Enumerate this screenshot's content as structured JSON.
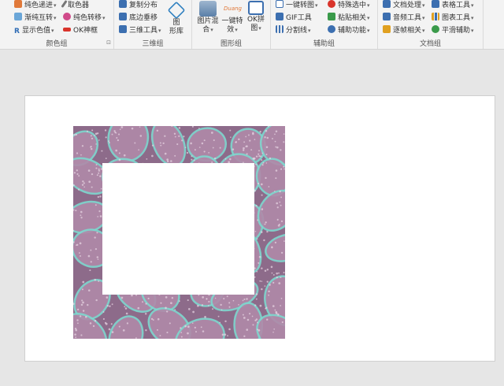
{
  "ribbon": {
    "groups": {
      "color": {
        "label": "颜色组",
        "items": [
          {
            "label": "纯色递进",
            "icon": "color-progress-icon",
            "color": "#e0793a"
          },
          {
            "label": "渐纯互转",
            "icon": "gradient-convert-icon",
            "color": "#6aa6d8"
          },
          {
            "label": "显示色值",
            "icon": "letter-r-icon",
            "color": "#2f6cb5"
          },
          {
            "label": "取色器",
            "icon": "eyedropper-icon",
            "color": "#555555"
          },
          {
            "label": "纯色转移",
            "icon": "color-transfer-icon",
            "color": "#d04a8a"
          },
          {
            "label": "OK神框",
            "icon": "ok-frame-icon",
            "color": "#d9342b"
          }
        ]
      },
      "three_d": {
        "label": "三维组",
        "items": [
          {
            "label": "复制分布",
            "icon": "copy-distribute-icon",
            "color": "#3c6fb0"
          },
          {
            "label": "底边垂移",
            "icon": "bottom-shift-icon",
            "color": "#3c6fb0"
          },
          {
            "label": "三维工具",
            "icon": "3d-cube-icon",
            "color": "#3c6fb0"
          }
        ],
        "big": {
          "label_line1": "图",
          "label_line2": "形库",
          "icon": "shape-library-icon",
          "color": "#2f80c0"
        }
      },
      "graphics": {
        "label": "图形组",
        "big_items": [
          {
            "label_line1": "图片混",
            "label_line2": "合",
            "icon": "image-blend-icon",
            "color": "#5a7fa8"
          },
          {
            "label_line1": "一键特",
            "label_line2": "效",
            "icon": "duang-icon",
            "color": "#e0793a",
            "icon_text": "Duang"
          },
          {
            "label_line1": "OK拼",
            "label_line2": "图",
            "icon": "ok-puzzle-icon",
            "color": "#3c6fb0"
          }
        ]
      },
      "assist": {
        "label": "辅助组",
        "items": [
          {
            "label": "一键转图",
            "icon": "one-click-image-icon",
            "color": "#3c6fb0"
          },
          {
            "label": "GIF工具",
            "icon": "gif-tool-icon",
            "color": "#3c6fb0"
          },
          {
            "label": "分割线",
            "icon": "grid-split-icon",
            "color": "#3c6fb0"
          },
          {
            "label": "特殊选中",
            "icon": "special-select-icon",
            "color": "#d9342b"
          },
          {
            "label": "粘贴相关",
            "icon": "paste-icon",
            "color": "#3a9a4a"
          },
          {
            "label": "辅助功能",
            "icon": "assist-function-icon",
            "color": "#3c6fb0"
          }
        ]
      },
      "document": {
        "label": "文档组",
        "items": [
          {
            "label": "文档处理",
            "icon": "document-process-icon",
            "color": "#3c6fb0"
          },
          {
            "label": "音频工具",
            "icon": "audio-tool-icon",
            "color": "#3c6fb0"
          },
          {
            "label": "逐帧相关",
            "icon": "frame-by-frame-icon",
            "color": "#e0a020"
          },
          {
            "label": "表格工具",
            "icon": "table-tool-icon",
            "color": "#3c6fb0"
          },
          {
            "label": "图表工具",
            "icon": "chart-tool-icon",
            "color": "#e0a020"
          },
          {
            "label": "平滑辅助",
            "icon": "smooth-assist-icon",
            "color": "#3a9a4a"
          }
        ]
      }
    },
    "dropdown_glyph": "▾",
    "launcher_glyph": "⊡"
  },
  "slide": {
    "picture": {
      "name": "pattern-picture",
      "bg_color": "#8d6b8a",
      "blob_color": "#b08aa9",
      "outline_color": "#7fd8cf",
      "hole_color": "#ffffff"
    }
  }
}
